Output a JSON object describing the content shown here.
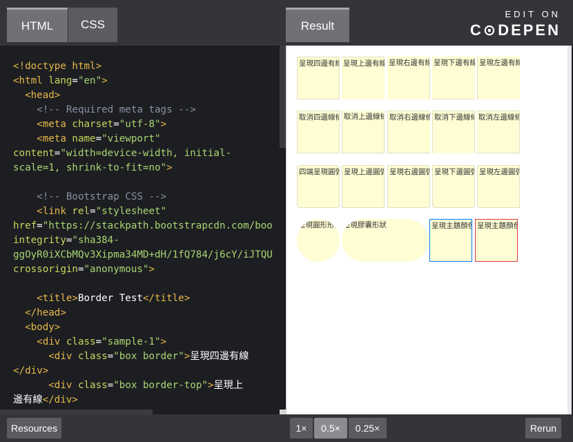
{
  "tabs": {
    "html": "HTML",
    "css": "CSS",
    "result": "Result"
  },
  "brand": {
    "top": "EDIT ON",
    "bottom": "C⊙DEPEN"
  },
  "code_lines": [
    [
      [
        "t",
        "<!doctype html>"
      ]
    ],
    [
      [
        "t",
        "<html "
      ],
      [
        "a",
        "lang"
      ],
      [
        "v",
        "="
      ],
      [
        "s",
        "\"en\""
      ],
      [
        "t",
        ">"
      ]
    ],
    [
      [
        "t",
        "  <head>"
      ]
    ],
    [
      [
        "c",
        "    <!-- Required meta tags -->"
      ]
    ],
    [
      [
        "t",
        "    <meta "
      ],
      [
        "a",
        "charset"
      ],
      [
        "v",
        "="
      ],
      [
        "s",
        "\"utf-8\""
      ],
      [
        "t",
        ">"
      ]
    ],
    [
      [
        "t",
        "    <meta "
      ],
      [
        "a",
        "name"
      ],
      [
        "v",
        "="
      ],
      [
        "s",
        "\"viewport\""
      ]
    ],
    [
      [
        "a",
        "content"
      ],
      [
        "v",
        "="
      ],
      [
        "s",
        "\"width=device-width, initial-"
      ]
    ],
    [
      [
        "s",
        "scale=1, shrink-to-fit=no\""
      ],
      [
        "t",
        ">"
      ]
    ],
    [],
    [
      [
        "c",
        "    <!-- Bootstrap CSS -->"
      ]
    ],
    [
      [
        "t",
        "    <link "
      ],
      [
        "a",
        "rel"
      ],
      [
        "v",
        "="
      ],
      [
        "s",
        "\"stylesheet\""
      ]
    ],
    [
      [
        "a",
        "href"
      ],
      [
        "v",
        "="
      ],
      [
        "s",
        "\"https://stackpath.bootstrapcdn.com/boo"
      ]
    ],
    [
      [
        "a",
        "integrity"
      ],
      [
        "v",
        "="
      ],
      [
        "s",
        "\"sha384-"
      ]
    ],
    [
      [
        "s",
        "ggOyR0iXCbMQv3Xipma34MD+dH/1fQ784/j6cY/iJTQU"
      ]
    ],
    [
      [
        "a",
        "crossorigin"
      ],
      [
        "v",
        "="
      ],
      [
        "s",
        "\"anonymous\""
      ],
      [
        "t",
        ">"
      ]
    ],
    [],
    [
      [
        "t",
        "    <title>"
      ],
      [
        "v",
        "Border Test"
      ],
      [
        "t",
        "</title>"
      ]
    ],
    [
      [
        "t",
        "  </head>"
      ]
    ],
    [
      [
        "t",
        "  <body>"
      ]
    ],
    [
      [
        "t",
        "    <div "
      ],
      [
        "a",
        "class"
      ],
      [
        "v",
        "="
      ],
      [
        "s",
        "\"sample-1\""
      ],
      [
        "t",
        ">"
      ]
    ],
    [
      [
        "t",
        "      <div "
      ],
      [
        "a",
        "class"
      ],
      [
        "v",
        "="
      ],
      [
        "s",
        "\"box border\""
      ],
      [
        "t",
        ">"
      ],
      [
        "v",
        "呈現四邊有線"
      ]
    ],
    [
      [
        "t",
        "</div>"
      ]
    ],
    [
      [
        "t",
        "      <div "
      ],
      [
        "a",
        "class"
      ],
      [
        "v",
        "="
      ],
      [
        "s",
        "\"box border-top\""
      ],
      [
        "t",
        ">"
      ],
      [
        "v",
        "呈現上"
      ]
    ],
    [
      [
        "v",
        "邊有線"
      ],
      [
        "t",
        "</div>"
      ]
    ]
  ],
  "result_rows": [
    [
      "呈現四邊有線",
      "呈現上邊有線",
      "呈現右邊有線",
      "呈現下邊有線",
      "呈現左邊有線"
    ],
    [
      "取消四邊線條",
      "取消上邊線條",
      "取消右邊線條",
      "取消下邊線條",
      "取消左邊線條"
    ],
    [
      "四端呈現圓弧",
      "呈現上邊圓弧",
      "呈現右邊圓弧",
      "呈現下邊圓弧",
      "呈現左邊圓弧"
    ],
    [
      "呈現圓形形狀",
      "呈現膠囊形狀",
      "呈現主題顏色",
      "呈現主題顏色"
    ]
  ],
  "colors": {
    "primary": "#007bff",
    "danger": "#dc3545",
    "box_bg": "#fffdd4"
  },
  "footer": {
    "resources": "Resources",
    "z1": "1×",
    "z05": "0.5×",
    "z025": "0.25×",
    "rerun": "Rerun"
  }
}
